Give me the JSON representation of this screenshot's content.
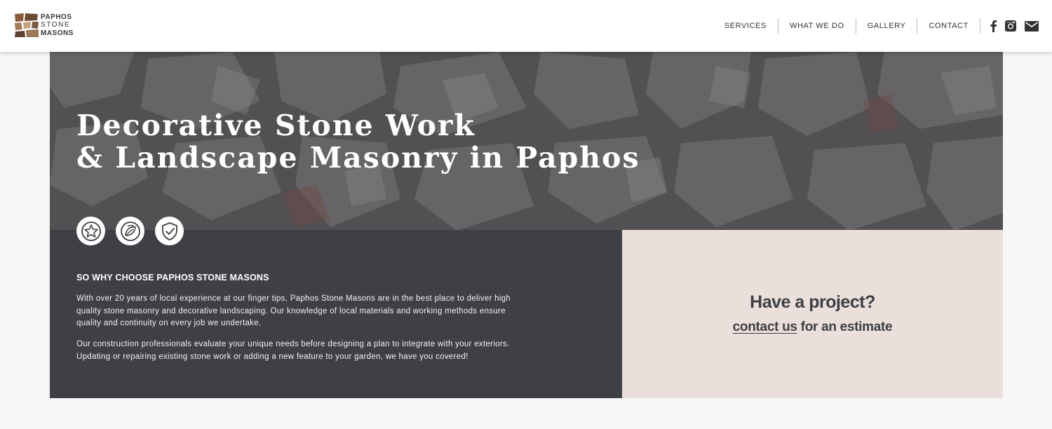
{
  "brand": {
    "line1": "PAPHOS",
    "line2": "STONE",
    "line3": "MASONS"
  },
  "nav": {
    "items": [
      "SERVICES",
      "WHAT WE DO",
      "GALLERY",
      "CONTACT"
    ],
    "social_icons": [
      "facebook-icon",
      "instagram-icon",
      "email-icon"
    ]
  },
  "hero": {
    "title_line1": "Decorative Stone Work",
    "title_line2": "& Landscape Masonry in Paphos",
    "badge_icons": [
      "star-icon",
      "leaf-icon",
      "shield-check-icon"
    ]
  },
  "why": {
    "heading": "SO WHY CHOOSE PAPHOS STONE MASONS",
    "paragraph1": "With over 20 years of local experience at our finger tips, Paphos Stone Masons are in the best place to deliver high quality stone masonry and decorative landscaping. Our knowledge of local materials and working methods ensure quality and continuity on every job we undertake.",
    "paragraph2": "Our construction professionals evaluate your unique needs before designing a plan to integrate with your exteriors. Updating or repairing existing stone work or adding a new feature to your garden, we have you covered!"
  },
  "project": {
    "title": "Have a project?",
    "link_text": "contact us",
    "suffix": " for an estimate"
  },
  "colors": {
    "dark_panel": "#3f4045",
    "project_panel": "#eadfdb",
    "header_bg": "#ffffff"
  }
}
